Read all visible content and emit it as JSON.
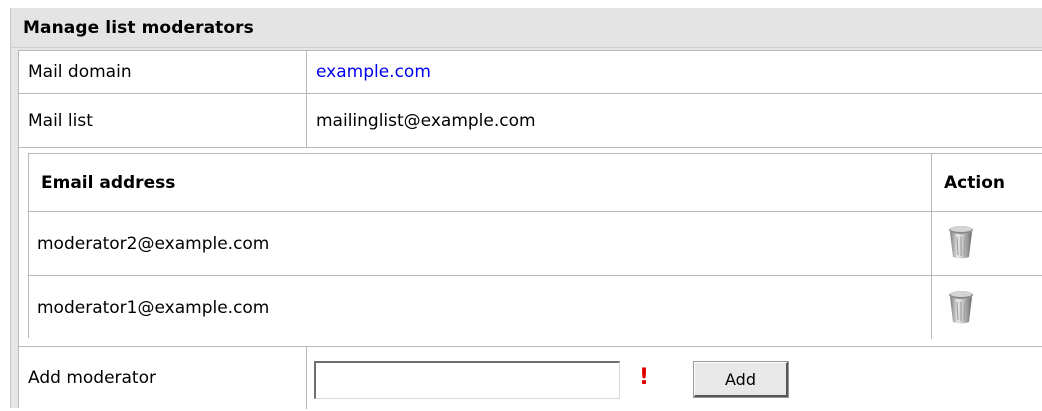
{
  "panel": {
    "title": "Manage list moderators"
  },
  "details": {
    "mail_domain_label": "Mail domain",
    "mail_domain_value": "example.com",
    "mail_list_label": "Mail list",
    "mail_list_value": "mailinglist@example.com"
  },
  "moderators_table": {
    "columns": [
      "Email address",
      "Action"
    ],
    "rows": [
      {
        "email": "moderator2@example.com",
        "action_icon": "trash-icon"
      },
      {
        "email": "moderator1@example.com",
        "action_icon": "trash-icon"
      }
    ]
  },
  "add_form": {
    "label": "Add moderator",
    "input_value": "",
    "required_marker": "!",
    "button_label": "Add"
  },
  "colors": {
    "link": "#0000ee",
    "required": "#e00000",
    "header_bg": "#e4e4e4"
  }
}
